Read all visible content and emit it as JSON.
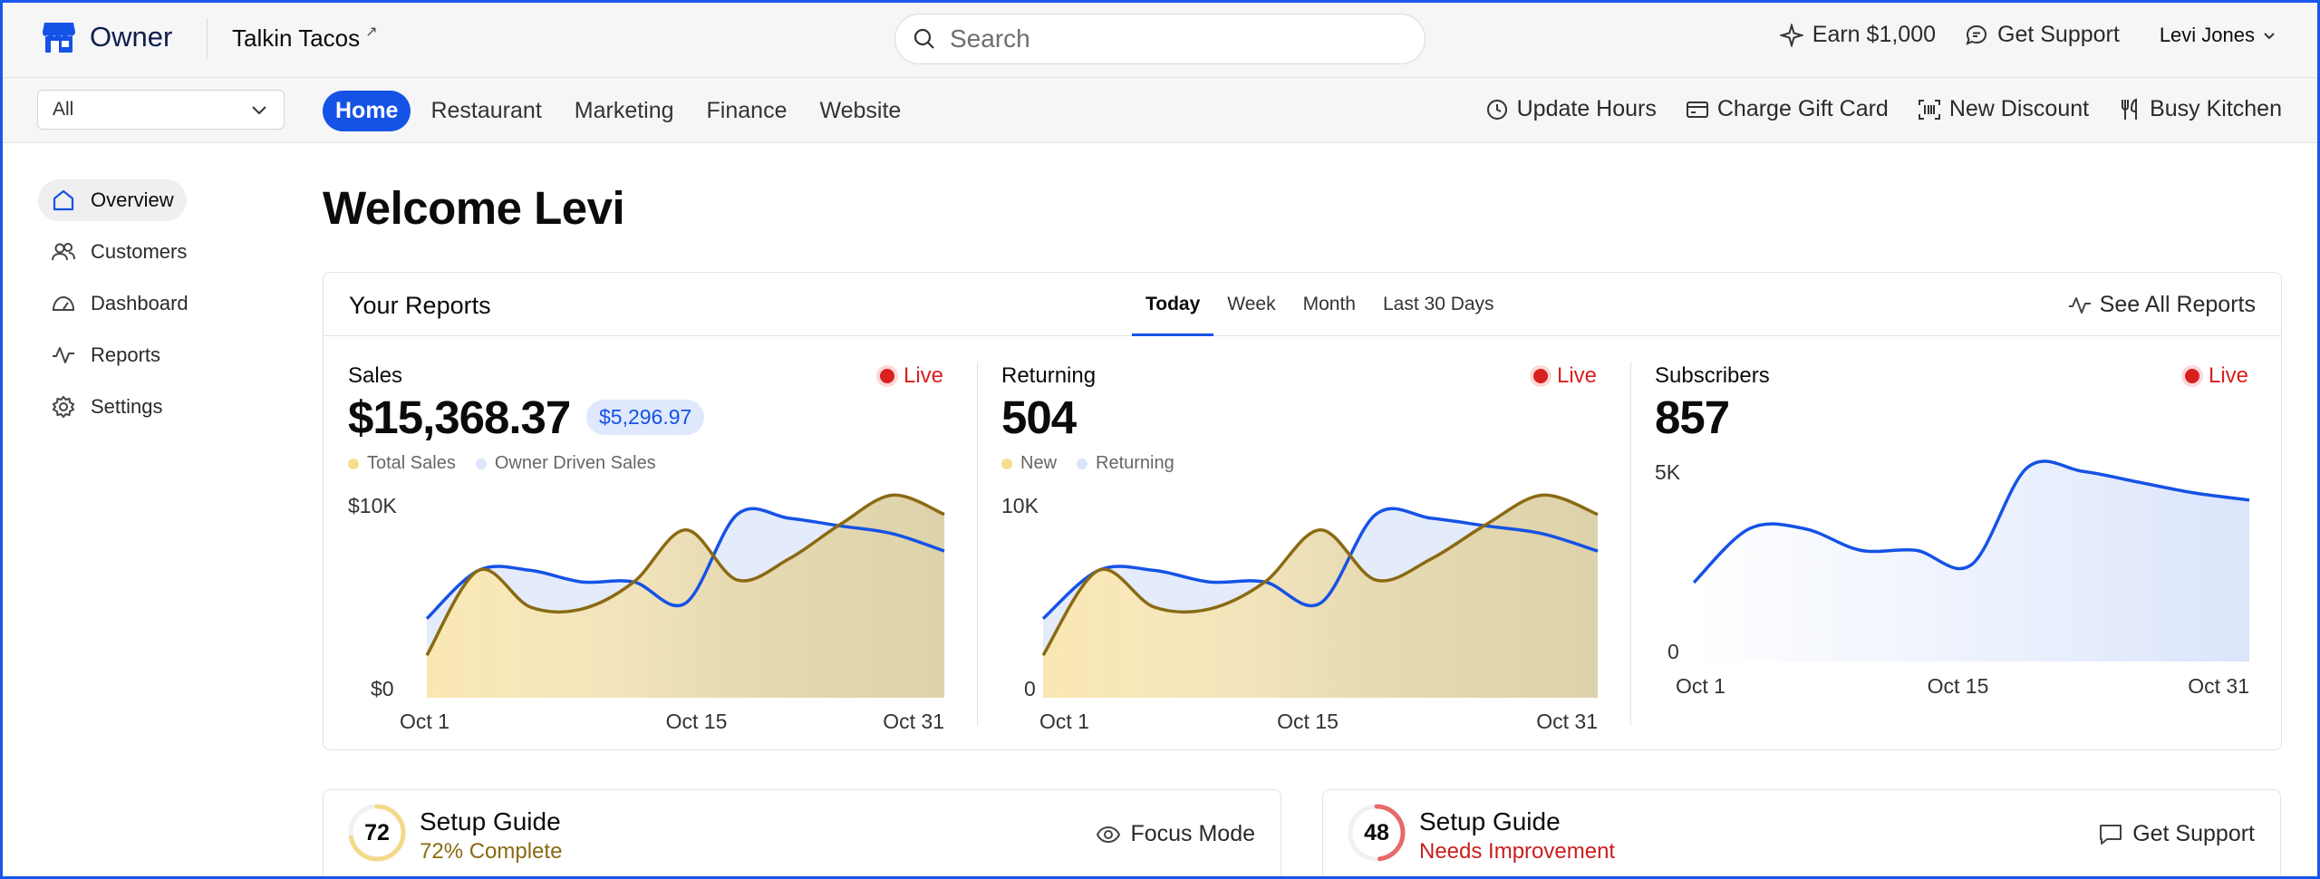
{
  "app": {
    "name": "Owner",
    "restaurant": "Talkin Tacos"
  },
  "search": {
    "placeholder": "Search"
  },
  "top_actions": [
    {
      "label": "Earn $1,000",
      "icon": "sparkle-icon"
    },
    {
      "label": "Get Support",
      "icon": "chat-icon"
    }
  ],
  "user": {
    "name": "Levi Jones"
  },
  "location_select": {
    "value": "All"
  },
  "nav_tabs": [
    {
      "label": "Home",
      "active": true
    },
    {
      "label": "Restaurant",
      "active": false
    },
    {
      "label": "Marketing",
      "active": false
    },
    {
      "label": "Finance",
      "active": false
    },
    {
      "label": "Website",
      "active": false
    }
  ],
  "quick_actions": [
    {
      "label": "Update Hours",
      "icon": "clock-icon"
    },
    {
      "label": "Charge Gift Card",
      "icon": "card-icon"
    },
    {
      "label": "New Discount",
      "icon": "barcode-icon"
    },
    {
      "label": "Busy Kitchen",
      "icon": "utensils-icon"
    }
  ],
  "sidebar": {
    "items": [
      {
        "label": "Overview",
        "icon": "home-icon",
        "active": true
      },
      {
        "label": "Customers",
        "icon": "users-icon",
        "active": false
      },
      {
        "label": "Dashboard",
        "icon": "gauge-icon",
        "active": false
      },
      {
        "label": "Reports",
        "icon": "activity-icon",
        "active": false
      },
      {
        "label": "Settings",
        "icon": "gear-icon",
        "active": false
      }
    ]
  },
  "main": {
    "welcome": "Welcome Levi",
    "reports": {
      "title": "Your Reports",
      "period_tabs": [
        {
          "label": "Today",
          "active": true
        },
        {
          "label": "Week",
          "active": false
        },
        {
          "label": "Month",
          "active": false
        },
        {
          "label": "Last 30 Days",
          "active": false
        }
      ],
      "see_all": "See All Reports",
      "live_label": "Live",
      "panels": [
        {
          "name": "Sales",
          "value": "$15,368.37",
          "badge": "$5,296.97",
          "legend": [
            "Total Sales",
            "Owner Driven Sales"
          ]
        },
        {
          "name": "Returning",
          "value": "504",
          "legend": [
            "New",
            "Returning"
          ]
        },
        {
          "name": "Subscribers",
          "value": "857"
        }
      ]
    },
    "setup_cards": [
      {
        "score": "72",
        "title": "Setup Guide",
        "subtitle": "72% Complete",
        "action": "Focus Mode",
        "progress": 0.72,
        "color": "#8a6a12"
      },
      {
        "score": "48",
        "title": "Setup Guide",
        "subtitle": "Needs Improvement",
        "action": "Get Support",
        "progress": 0.48,
        "color": "#c81e1e"
      }
    ]
  },
  "colors": {
    "accent": "#1552e6",
    "gold_line": "#8a6a12",
    "gold_fill": "#f3d98a",
    "blue_fill": "#dbe5fb",
    "live": "#d92020"
  },
  "chart_data": [
    {
      "type": "area",
      "title": "Sales",
      "x": [
        "Oct 1",
        "Oct 4",
        "Oct 7",
        "Oct 10",
        "Oct 13",
        "Oct 16",
        "Oct 19",
        "Oct 22",
        "Oct 25",
        "Oct 28",
        "Oct 31"
      ],
      "series": [
        {
          "name": "Total Sales",
          "values": [
            2200,
            6600,
            4700,
            4600,
            6000,
            8700,
            6100,
            7200,
            9000,
            10500,
            9500
          ]
        },
        {
          "name": "Owner Driven Sales",
          "values": [
            4100,
            6600,
            6600,
            6000,
            6000,
            4900,
            9500,
            9300,
            8900,
            8500,
            7600
          ]
        }
      ],
      "ylim": [
        0,
        10000
      ],
      "yticks": [
        "$0",
        "$10K"
      ],
      "xticks": [
        "Oct 1",
        "Oct 15",
        "Oct 31"
      ]
    },
    {
      "type": "area",
      "title": "Returning",
      "x": [
        "Oct 1",
        "Oct 4",
        "Oct 7",
        "Oct 10",
        "Oct 13",
        "Oct 16",
        "Oct 19",
        "Oct 22",
        "Oct 25",
        "Oct 28",
        "Oct 31"
      ],
      "series": [
        {
          "name": "New",
          "values": [
            2200,
            6600,
            4700,
            4600,
            6000,
            8700,
            6100,
            7200,
            9000,
            10500,
            9500
          ]
        },
        {
          "name": "Returning",
          "values": [
            4100,
            6600,
            6600,
            6000,
            6000,
            4900,
            9500,
            9300,
            8900,
            8500,
            7600
          ]
        }
      ],
      "ylim": [
        0,
        10000
      ],
      "yticks": [
        "0",
        "10K"
      ],
      "xticks": [
        "Oct 1",
        "Oct 15",
        "Oct 31"
      ]
    },
    {
      "type": "area",
      "title": "Subscribers",
      "x": [
        "Oct 1",
        "Oct 4",
        "Oct 7",
        "Oct 10",
        "Oct 13",
        "Oct 16",
        "Oct 19",
        "Oct 22",
        "Oct 25",
        "Oct 28",
        "Oct 31"
      ],
      "series": [
        {
          "name": "Subscribers",
          "values": [
            2200,
            3700,
            3700,
            3100,
            3100,
            2700,
            5400,
            5300,
            5000,
            4700,
            4500
          ]
        }
      ],
      "ylim": [
        0,
        5000
      ],
      "yticks": [
        "0",
        "5K"
      ],
      "xticks": [
        "Oct 1",
        "Oct 15",
        "Oct 31"
      ]
    }
  ]
}
